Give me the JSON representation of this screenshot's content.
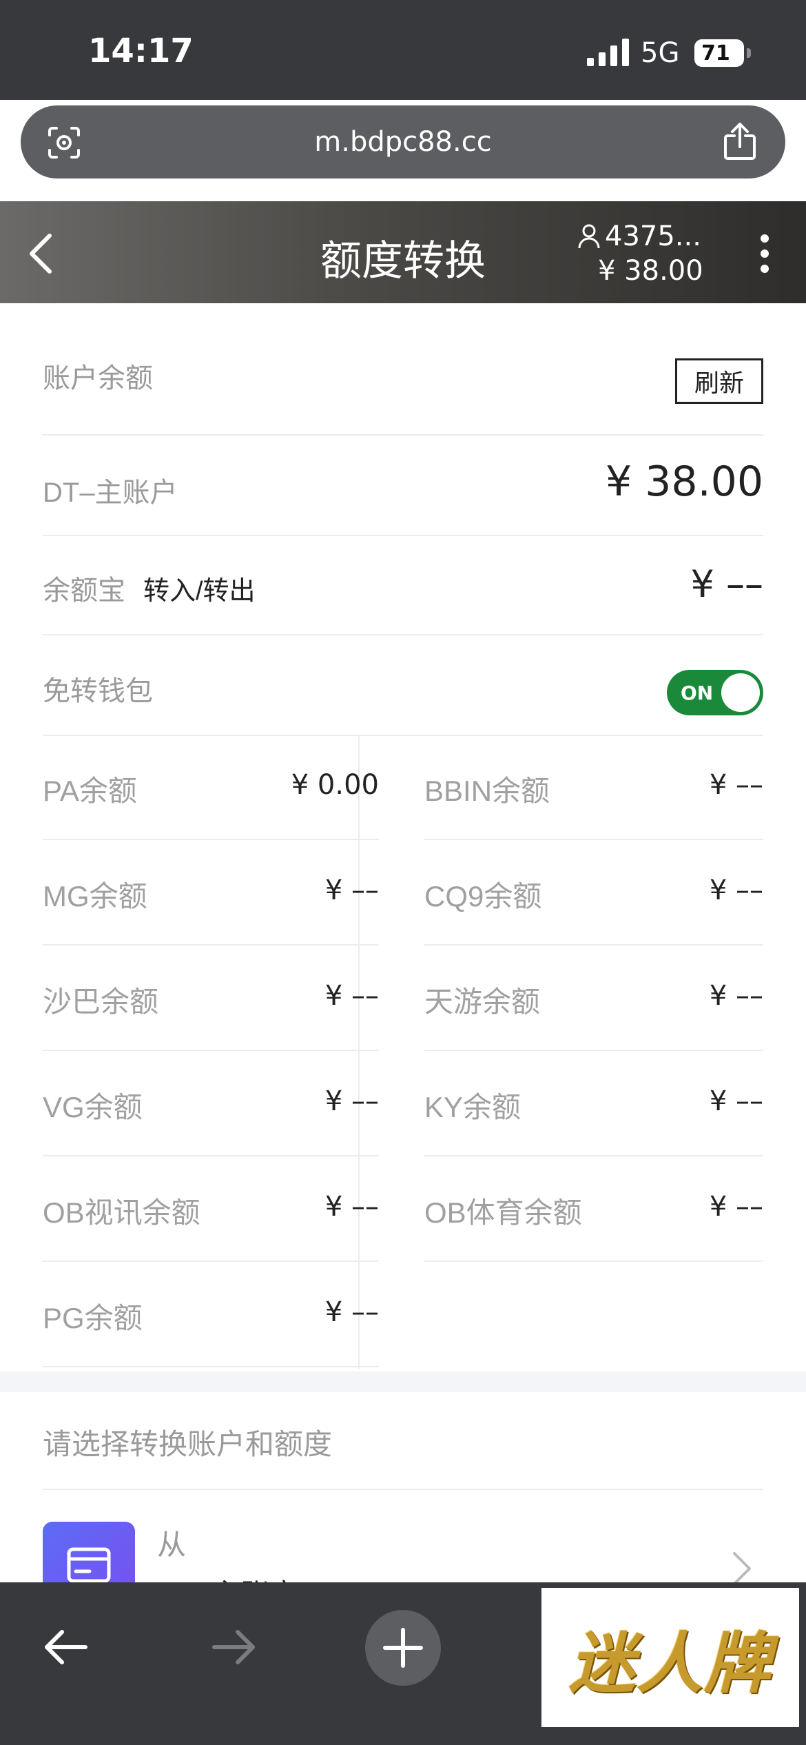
{
  "status_bar": {
    "time": "14:17",
    "network": "5G",
    "battery": "71"
  },
  "browser": {
    "url": "m.bdpc88.cc"
  },
  "header": {
    "title": "额度转换",
    "user_id": "4375...",
    "balance": "¥ 38.00"
  },
  "account": {
    "balance_label": "账户余额",
    "refresh_label": "刷新",
    "main_label": "DT–主账户",
    "main_value": "¥ 38.00",
    "yuebao_label": "余额宝",
    "yuebao_action": "转入/转出",
    "yuebao_value": "¥ ––",
    "wallet_label": "免转钱包",
    "wallet_toggle": "ON"
  },
  "platforms": [
    {
      "label": "PA余额",
      "value": "¥ 0.00"
    },
    {
      "label": "BBIN余额",
      "value": "¥ ––"
    },
    {
      "label": "MG余额",
      "value": "¥ ––"
    },
    {
      "label": "CQ9余额",
      "value": "¥ ––"
    },
    {
      "label": "沙巴余额",
      "value": "¥ ––"
    },
    {
      "label": "天游余额",
      "value": "¥ ––"
    },
    {
      "label": "VG余额",
      "value": "¥ ––"
    },
    {
      "label": "KY余额",
      "value": "¥ ––"
    },
    {
      "label": "OB视讯余额",
      "value": "¥ ––"
    },
    {
      "label": "OB体育余额",
      "value": "¥ ––"
    },
    {
      "label": "PG余额",
      "value": "¥ ––"
    }
  ],
  "transfer": {
    "title": "请选择转换账户和额度",
    "from_label": "从",
    "from_value": "DT–主账户"
  },
  "watermark": {
    "text": "迷人牌"
  },
  "colors": {
    "toggle_on": "#1a8a3a",
    "header_dark": "#37393d",
    "wallet_icon": "#6a5cf2"
  }
}
